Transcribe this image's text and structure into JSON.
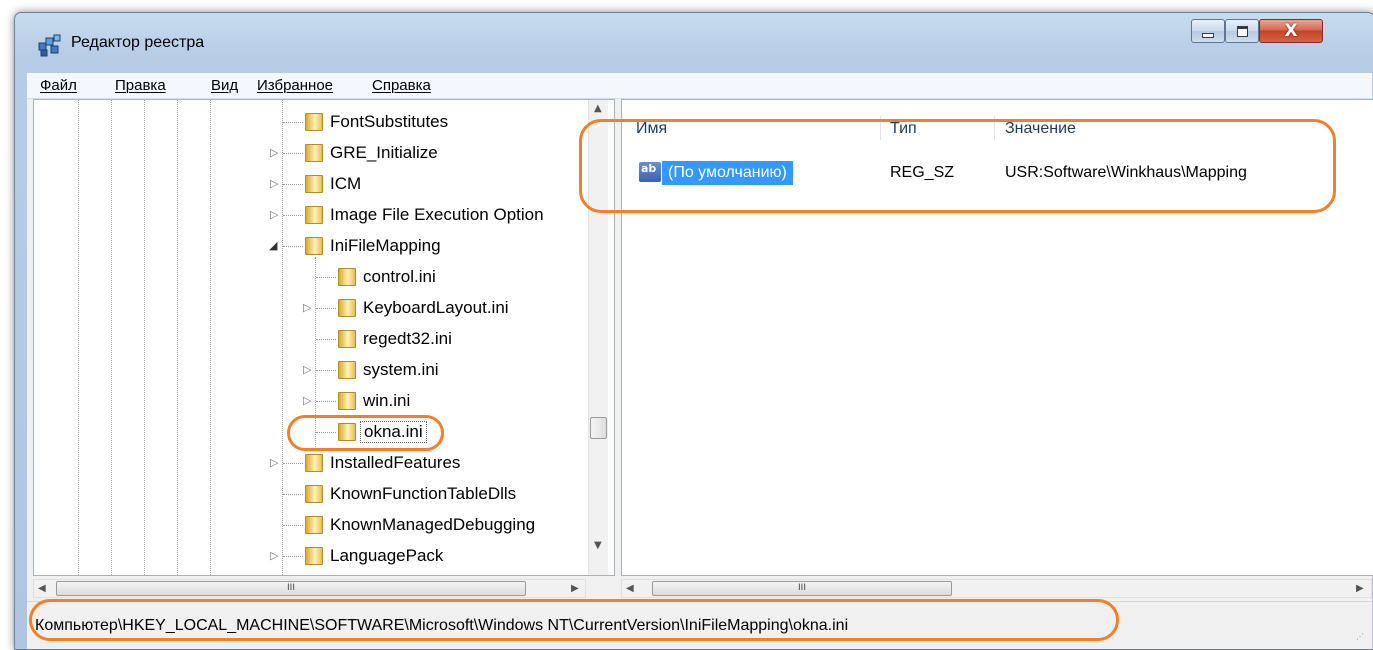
{
  "window": {
    "title": "Редактор реестра",
    "close_glyph": "X"
  },
  "menu": {
    "items": [
      "Файл",
      "Правка",
      "Вид",
      "Избранное",
      "Справка"
    ]
  },
  "tree": {
    "items": [
      {
        "label": "FontSubstitutes",
        "expander": ""
      },
      {
        "label": "GRE_Initialize",
        "expander": "▷"
      },
      {
        "label": "ICM",
        "expander": "▷"
      },
      {
        "label": "Image File Execution Option",
        "expander": "▷"
      },
      {
        "label": "IniFileMapping",
        "expander": "◢"
      },
      {
        "label": "control.ini",
        "expander": ""
      },
      {
        "label": "KeyboardLayout.ini",
        "expander": "▷"
      },
      {
        "label": "regedt32.ini",
        "expander": ""
      },
      {
        "label": "system.ini",
        "expander": "▷"
      },
      {
        "label": "win.ini",
        "expander": "▷"
      },
      {
        "label": "okna.ini",
        "expander": ""
      },
      {
        "label": "InstalledFeatures",
        "expander": "▷"
      },
      {
        "label": "KnownFunctionTableDlls",
        "expander": ""
      },
      {
        "label": "KnownManagedDebugging",
        "expander": ""
      },
      {
        "label": "LanguagePack",
        "expander": "▷"
      }
    ]
  },
  "list": {
    "columns": {
      "name": "Имя",
      "type": "Тип",
      "value": "Значение"
    },
    "rows": [
      {
        "icon": "ab",
        "name": "(По умолчанию)",
        "type": "REG_SZ",
        "value": "USR:Software\\Winkhaus\\Mapping"
      }
    ]
  },
  "scroll": {
    "thumb_glyph": "III"
  },
  "status": {
    "path": "Компьютер\\HKEY_LOCAL_MACHINE\\SOFTWARE\\Microsoft\\Windows NT\\CurrentVersion\\IniFileMapping\\okna.ini"
  },
  "colors": {
    "annotation": "#f37f2a",
    "selection": "#3399ff"
  }
}
